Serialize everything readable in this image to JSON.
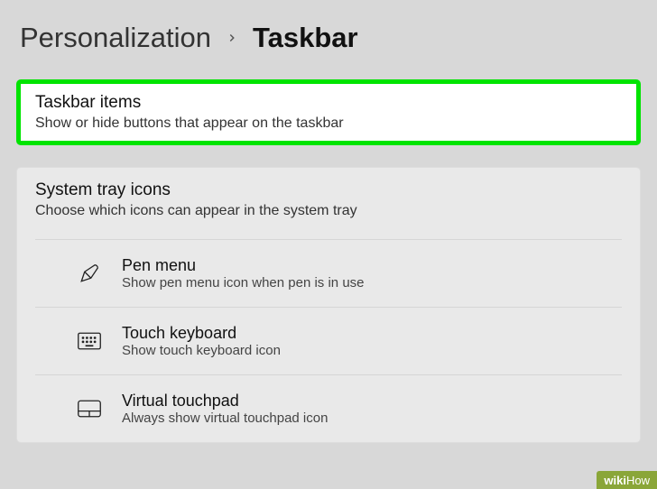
{
  "breadcrumb": {
    "parent": "Personalization",
    "current": "Taskbar"
  },
  "sections": {
    "taskbar_items": {
      "title": "Taskbar items",
      "subtitle": "Show or hide buttons that appear on the taskbar"
    },
    "system_tray": {
      "title": "System tray icons",
      "subtitle": "Choose which icons can appear in the system tray",
      "items": [
        {
          "title": "Pen menu",
          "subtitle": "Show pen menu icon when pen is in use"
        },
        {
          "title": "Touch keyboard",
          "subtitle": "Show touch keyboard icon"
        },
        {
          "title": "Virtual touchpad",
          "subtitle": "Always show virtual touchpad icon"
        }
      ]
    }
  },
  "watermark": {
    "brand": "wiki",
    "suffix": "How"
  }
}
